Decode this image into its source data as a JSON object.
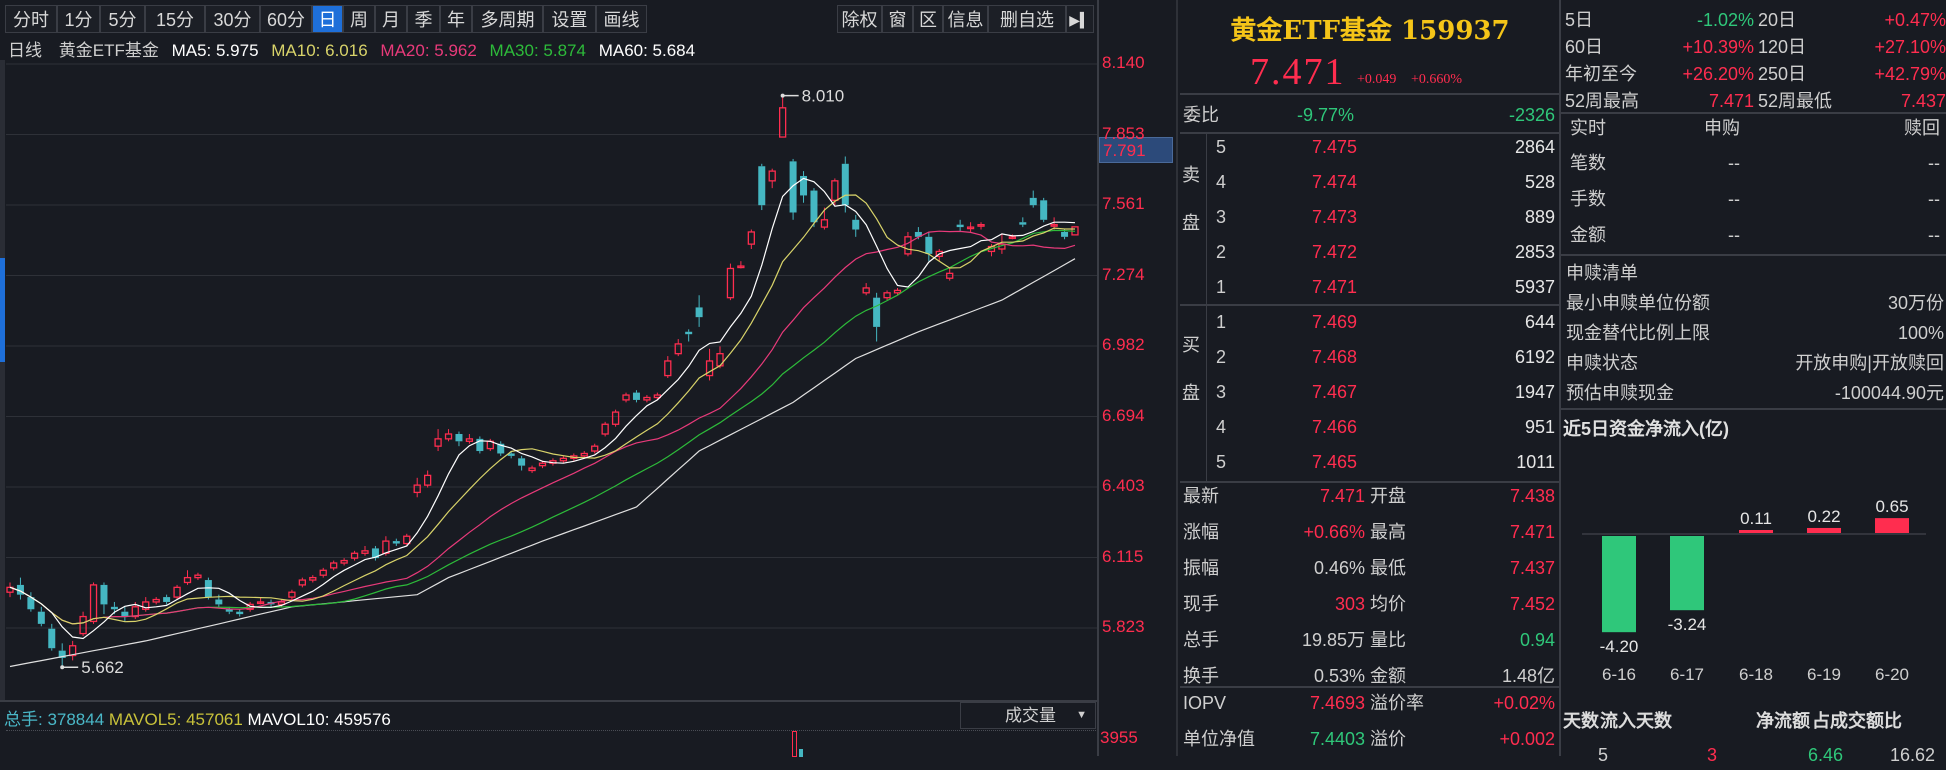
{
  "toolbar": {
    "periods": [
      "分时",
      "1分",
      "5分",
      "15分",
      "30分",
      "60分",
      "日",
      "周",
      "月",
      "季",
      "年",
      "多周期",
      "设置",
      "画线"
    ],
    "active": "日",
    "right_buttons": [
      "除权",
      "窗",
      "区",
      "信息",
      "删自选"
    ],
    "collapse_icon": "collapse-right-icon"
  },
  "chart_info": {
    "period": "日线",
    "name": "黄金ETF基金",
    "ma5": "MA5: 5.975",
    "ma10": "MA10: 6.016",
    "ma20": "MA20: 5.962",
    "ma30": "MA30: 5.874",
    "ma60": "MA60: 5.684"
  },
  "colors": {
    "up": "#ff2d4f",
    "down": "#45b7c2",
    "ma5": "#ffffff",
    "ma10": "#d8d36a",
    "ma20": "#e83a7a",
    "ma30": "#2dbb3a",
    "ma60": "#e0e0e0",
    "accent": "#1e6fd9",
    "title": "#f5c518"
  },
  "chart_data": {
    "type": "candlestick",
    "yticks": [
      "8.140",
      "7.853",
      "7.561",
      "7.274",
      "6.982",
      "6.694",
      "6.403",
      "6.115",
      "5.823"
    ],
    "ylim": [
      5.823,
      8.14
    ],
    "crosshair_price": "7.791",
    "max_label": "8.010",
    "min_label": "5.662",
    "candles": [
      [
        5.97,
        6.01,
        5.95,
        5.99
      ],
      [
        6.0,
        6.03,
        5.94,
        5.96
      ],
      [
        5.95,
        5.97,
        5.89,
        5.9
      ],
      [
        5.89,
        5.91,
        5.83,
        5.84
      ],
      [
        5.82,
        5.84,
        5.73,
        5.74
      ],
      [
        5.73,
        5.76,
        5.662,
        5.7
      ],
      [
        5.71,
        5.77,
        5.69,
        5.75
      ],
      [
        5.8,
        5.89,
        5.79,
        5.87
      ],
      [
        5.85,
        6.01,
        5.84,
        6.0
      ],
      [
        6.0,
        6.01,
        5.88,
        5.92
      ],
      [
        5.91,
        5.93,
        5.88,
        5.9
      ],
      [
        5.89,
        5.91,
        5.85,
        5.87
      ],
      [
        5.87,
        5.93,
        5.86,
        5.91
      ],
      [
        5.9,
        5.95,
        5.89,
        5.93
      ],
      [
        5.93,
        5.95,
        5.92,
        5.94
      ],
      [
        5.95,
        5.96,
        5.92,
        5.93
      ],
      [
        5.95,
        6.0,
        5.94,
        5.99
      ],
      [
        6.01,
        6.06,
        6.0,
        6.03
      ],
      [
        6.03,
        6.05,
        6.02,
        6.04
      ],
      [
        6.02,
        6.03,
        5.94,
        5.95
      ],
      [
        5.94,
        5.96,
        5.91,
        5.92
      ],
      [
        5.9,
        5.91,
        5.88,
        5.89
      ],
      [
        5.89,
        5.9,
        5.87,
        5.88
      ],
      [
        5.9,
        5.93,
        5.89,
        5.92
      ],
      [
        5.93,
        5.95,
        5.92,
        5.93
      ],
      [
        5.93,
        5.94,
        5.91,
        5.92
      ],
      [
        5.92,
        5.94,
        5.91,
        5.93
      ],
      [
        5.95,
        5.98,
        5.94,
        5.97
      ],
      [
        6.0,
        6.03,
        5.99,
        6.02
      ],
      [
        6.02,
        6.04,
        6.01,
        6.03
      ],
      [
        6.04,
        6.07,
        6.03,
        6.06
      ],
      [
        6.07,
        6.1,
        6.06,
        6.09
      ],
      [
        6.09,
        6.11,
        6.08,
        6.1
      ],
      [
        6.11,
        6.14,
        6.1,
        6.13
      ],
      [
        6.13,
        6.16,
        6.12,
        6.14
      ],
      [
        6.15,
        6.16,
        6.1,
        6.11
      ],
      [
        6.13,
        6.2,
        6.12,
        6.18
      ],
      [
        6.18,
        6.19,
        6.16,
        6.17
      ],
      [
        6.17,
        6.21,
        6.16,
        6.2
      ],
      [
        6.38,
        6.44,
        6.36,
        6.41
      ],
      [
        6.41,
        6.47,
        6.4,
        6.45
      ],
      [
        6.57,
        6.64,
        6.55,
        6.6
      ],
      [
        6.6,
        6.64,
        6.59,
        6.62
      ],
      [
        6.62,
        6.63,
        6.57,
        6.59
      ],
      [
        6.59,
        6.62,
        6.58,
        6.6
      ],
      [
        6.6,
        6.61,
        6.54,
        6.55
      ],
      [
        6.56,
        6.6,
        6.55,
        6.59
      ],
      [
        6.58,
        6.59,
        6.53,
        6.54
      ],
      [
        6.54,
        6.55,
        6.52,
        6.53
      ],
      [
        6.52,
        6.53,
        6.47,
        6.49
      ],
      [
        6.47,
        6.49,
        6.46,
        6.48
      ],
      [
        6.49,
        6.51,
        6.48,
        6.5
      ],
      [
        6.5,
        6.52,
        6.49,
        6.51
      ],
      [
        6.51,
        6.53,
        6.5,
        6.52
      ],
      [
        6.52,
        6.54,
        6.51,
        6.53
      ],
      [
        6.53,
        6.55,
        6.52,
        6.54
      ],
      [
        6.55,
        6.58,
        6.54,
        6.57
      ],
      [
        6.62,
        6.67,
        6.61,
        6.66
      ],
      [
        6.66,
        6.72,
        6.65,
        6.71
      ],
      [
        6.76,
        6.79,
        6.75,
        6.78
      ],
      [
        6.79,
        6.8,
        6.75,
        6.76
      ],
      [
        6.76,
        6.78,
        6.75,
        6.77
      ],
      [
        6.77,
        6.79,
        6.76,
        6.78
      ],
      [
        6.86,
        6.94,
        6.85,
        6.92
      ],
      [
        6.95,
        7.01,
        6.94,
        6.99
      ],
      [
        7.04,
        7.05,
        7.0,
        7.03
      ],
      [
        7.14,
        7.19,
        7.06,
        7.1
      ],
      [
        6.86,
        6.97,
        6.84,
        6.92
      ],
      [
        6.9,
        6.98,
        6.89,
        6.95
      ],
      [
        7.18,
        7.32,
        7.17,
        7.3
      ],
      [
        7.31,
        7.33,
        7.3,
        7.31
      ],
      [
        7.4,
        7.46,
        7.38,
        7.45
      ],
      [
        7.72,
        7.73,
        7.54,
        7.56
      ],
      [
        7.66,
        7.71,
        7.63,
        7.7
      ],
      [
        7.84,
        8.01,
        7.84,
        7.96
      ],
      [
        7.74,
        7.75,
        7.5,
        7.53
      ],
      [
        7.68,
        7.7,
        7.57,
        7.6
      ],
      [
        7.62,
        7.63,
        7.47,
        7.49
      ],
      [
        7.47,
        7.55,
        7.46,
        7.5
      ],
      [
        7.58,
        7.67,
        7.56,
        7.66
      ],
      [
        7.73,
        7.76,
        7.53,
        7.56
      ],
      [
        7.5,
        7.52,
        7.43,
        7.46
      ],
      [
        7.2,
        7.24,
        7.19,
        7.22
      ],
      [
        7.18,
        7.2,
        7.0,
        7.06
      ],
      [
        7.18,
        7.21,
        7.17,
        7.2
      ],
      [
        7.2,
        7.22,
        7.19,
        7.21
      ],
      [
        7.36,
        7.45,
        7.35,
        7.43
      ],
      [
        7.45,
        7.47,
        7.42,
        7.43
      ],
      [
        7.43,
        7.45,
        7.33,
        7.36
      ],
      [
        7.35,
        7.38,
        7.33,
        7.37
      ],
      [
        7.26,
        7.3,
        7.25,
        7.28
      ],
      [
        7.48,
        7.5,
        7.45,
        7.47
      ],
      [
        7.47,
        7.49,
        7.45,
        7.47
      ],
      [
        7.48,
        7.49,
        7.46,
        7.48
      ],
      [
        7.37,
        7.4,
        7.35,
        7.39
      ],
      [
        7.38,
        7.44,
        7.36,
        7.4
      ],
      [
        7.43,
        7.44,
        7.42,
        7.43
      ],
      [
        7.49,
        7.51,
        7.47,
        7.48
      ],
      [
        7.59,
        7.62,
        7.55,
        7.56
      ],
      [
        7.58,
        7.59,
        7.49,
        7.5
      ],
      [
        7.48,
        7.51,
        7.46,
        7.48
      ],
      [
        7.45,
        7.46,
        7.42,
        7.43
      ],
      [
        7.438,
        7.471,
        7.437,
        7.471
      ]
    ],
    "ma60_points": [
      [
        0,
        5.665
      ],
      [
        13,
        5.77
      ],
      [
        27,
        5.91
      ],
      [
        39,
        5.96
      ],
      [
        42,
        6.03
      ],
      [
        51,
        6.18
      ],
      [
        60,
        6.32
      ],
      [
        66,
        6.55
      ],
      [
        75,
        6.75
      ],
      [
        81,
        6.93
      ],
      [
        87,
        7.04
      ],
      [
        95,
        7.17
      ],
      [
        102,
        7.34
      ]
    ]
  },
  "volume": {
    "total": "总手: 378844",
    "mavol5": "MAVOL5: 457061",
    "mavol10": "MAVOL10: 459576",
    "selector": "成交量",
    "axis_max": "3955"
  },
  "quote": {
    "title": "黄金ETF基金 159937",
    "price": "7.471",
    "change": "+0.049",
    "change_pct": "+0.660%",
    "weibi_label": "委比",
    "weibi_pct": "-9.77%",
    "weicha": "-2326",
    "sell_label": [
      "卖",
      "盘"
    ],
    "buy_label": [
      "买",
      "盘"
    ],
    "asks": [
      {
        "level": "5",
        "price": "7.475",
        "vol": "2864"
      },
      {
        "level": "4",
        "price": "7.474",
        "vol": "528"
      },
      {
        "level": "3",
        "price": "7.473",
        "vol": "889"
      },
      {
        "level": "2",
        "price": "7.472",
        "vol": "2853"
      },
      {
        "level": "1",
        "price": "7.471",
        "vol": "5937"
      }
    ],
    "bids": [
      {
        "level": "1",
        "price": "7.469",
        "vol": "644"
      },
      {
        "level": "2",
        "price": "7.468",
        "vol": "6192"
      },
      {
        "level": "3",
        "price": "7.467",
        "vol": "1947"
      },
      {
        "level": "4",
        "price": "7.466",
        "vol": "951"
      },
      {
        "level": "5",
        "price": "7.465",
        "vol": "1011"
      }
    ],
    "stats": [
      {
        "l1": "最新",
        "v1": "7.471",
        "c1": "red",
        "l2": "开盘",
        "v2": "7.438",
        "c2": "red"
      },
      {
        "l1": "涨幅",
        "v1": "+0.66%",
        "c1": "red",
        "l2": "最高",
        "v2": "7.471",
        "c2": "red"
      },
      {
        "l1": "振幅",
        "v1": "0.46%",
        "c1": "gray",
        "l2": "最低",
        "v2": "7.437",
        "c2": "red"
      },
      {
        "l1": "现手",
        "v1": "303",
        "c1": "red",
        "l2": "均价",
        "v2": "7.452",
        "c2": "red"
      },
      {
        "l1": "总手",
        "v1": "19.85万",
        "c1": "gray",
        "l2": "量比",
        "v2": "0.94",
        "c2": "green"
      },
      {
        "l1": "换手",
        "v1": "0.53%",
        "c1": "gray",
        "l2": "金额",
        "v2": "1.48亿",
        "c2": "gray"
      }
    ],
    "etf": [
      {
        "l1": "IOPV",
        "v1": "7.4693",
        "c1": "red",
        "l2": "溢价率",
        "v2": "+0.02%",
        "c2": "red"
      },
      {
        "l1": "单位净值",
        "v1": "7.4403",
        "c1": "green",
        "l2": "溢价",
        "v2": "+0.002",
        "c2": "red"
      }
    ]
  },
  "returns": [
    {
      "l1": "5日",
      "v1": "-1.02%",
      "c1": "green",
      "l2": "20日",
      "v2": "+0.47%",
      "c2": "red"
    },
    {
      "l1": "60日",
      "v1": "+10.39%",
      "c1": "red",
      "l2": "120日",
      "v2": "+27.10%",
      "c2": "red"
    },
    {
      "l1": "年初至今",
      "v1": "+26.20%",
      "c1": "red",
      "l2": "250日",
      "v2": "+42.79%",
      "c2": "red"
    },
    {
      "l1": "52周最高",
      "v1": "7.471",
      "c1": "red",
      "l2": "52周最低",
      "v2": "7.437",
      "c2": "red"
    }
  ],
  "realtime": {
    "headers": [
      "实时",
      "申购",
      "赎回"
    ],
    "rows": [
      [
        "笔数",
        "--",
        "--"
      ],
      [
        "手数",
        "--",
        "--"
      ],
      [
        "金额",
        "--",
        "--"
      ]
    ]
  },
  "creation": {
    "title": "申赎清单",
    "rows": [
      [
        "最小申赎单位份额",
        "30万份"
      ],
      [
        "现金替代比例上限",
        "100%"
      ],
      [
        "申赎状态",
        "开放申购|开放赎回"
      ],
      [
        "预估申赎现金",
        "-100044.90元"
      ]
    ]
  },
  "flow": {
    "title": "近5日资金净流入(亿)",
    "dates": [
      "6-16",
      "6-17",
      "6-18",
      "6-19",
      "6-20"
    ],
    "values": [
      -4.2,
      -3.24,
      0.11,
      0.22,
      0.65
    ],
    "labels": [
      "-4.20",
      "-3.24",
      "0.11",
      "0.22",
      "0.65"
    ],
    "table_headers": [
      "天数",
      "流入天数",
      "净流额",
      "占成交额比"
    ],
    "table_row": [
      "5",
      "3",
      "6.46",
      "16.62"
    ]
  }
}
